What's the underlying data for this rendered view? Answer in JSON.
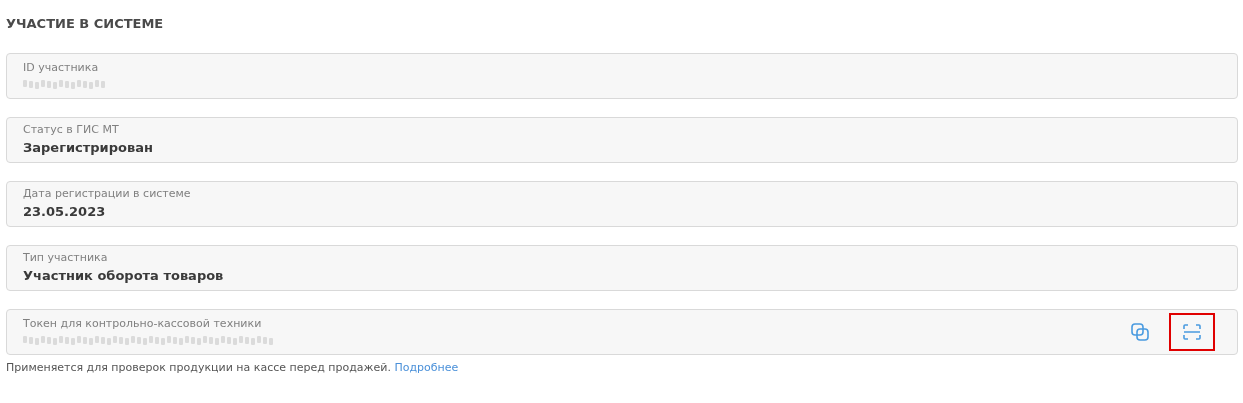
{
  "section_title": "УЧАСТИЕ В СИСТЕМЕ",
  "fields": [
    {
      "label": "ID участника",
      "masked": true
    },
    {
      "label": "Статус в ГИС МТ",
      "value": "Зарегистрирован",
      "masked": false
    },
    {
      "label": "Дата регистрации в системе",
      "value": "23.05.2023",
      "masked": false
    },
    {
      "label": "Тип участника",
      "value": "Участник оборота товаров",
      "masked": false
    },
    {
      "label": "Токен для контрольно-кассовой техники",
      "masked": true,
      "actions": [
        {
          "kind": "copy",
          "highlighted": false
        },
        {
          "kind": "scan",
          "highlighted": true
        }
      ]
    }
  ],
  "hint": {
    "text": "Применяется для проверок продукции на кассе перед продажей.",
    "link": "Подробнее"
  }
}
